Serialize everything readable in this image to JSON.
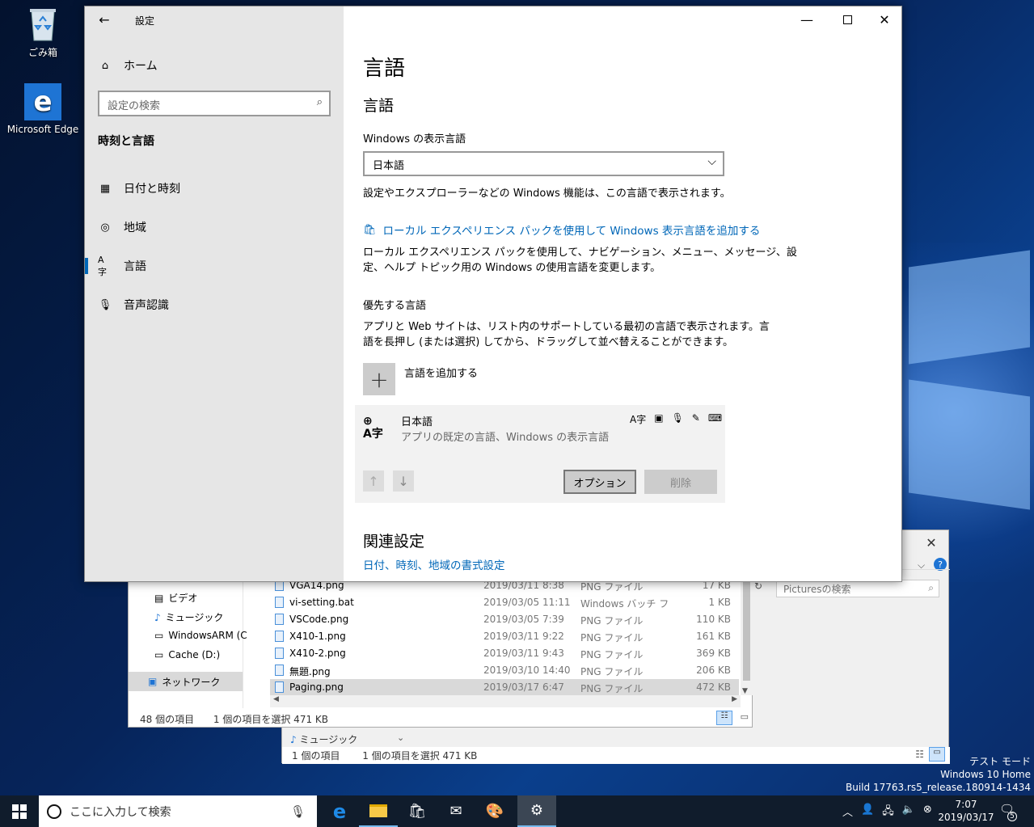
{
  "desktop": {
    "icons": [
      {
        "label": "ごみ箱"
      },
      {
        "label": "Microsoft Edge"
      }
    ],
    "watermark": {
      "line1": "テスト モード",
      "line2": "Windows 10 Home",
      "line3": "Build 17763.rs5_release.180914-1434"
    }
  },
  "explorer_back": {
    "nav_items": [
      "ビデオ",
      "ミュージック",
      "WindowsARM (C",
      "Cache (D:)",
      "ネットワーク"
    ],
    "files": [
      {
        "name": "VGA14.png",
        "date": "2019/03/11 8:38",
        "type": "PNG ファイル",
        "size": "17 KB"
      },
      {
        "name": "vi-setting.bat",
        "date": "2019/03/05 11:11",
        "type": "Windows バッチ ファ...",
        "size": "1 KB"
      },
      {
        "name": "VSCode.png",
        "date": "2019/03/05 7:39",
        "type": "PNG ファイル",
        "size": "110 KB"
      },
      {
        "name": "X410-1.png",
        "date": "2019/03/11 9:22",
        "type": "PNG ファイル",
        "size": "161 KB"
      },
      {
        "name": "X410-2.png",
        "date": "2019/03/11 9:43",
        "type": "PNG ファイル",
        "size": "369 KB"
      },
      {
        "name": "無題.png",
        "date": "2019/03/10 14:40",
        "type": "PNG ファイル",
        "size": "206 KB"
      },
      {
        "name": "Paging.png",
        "date": "2019/03/17 6:47",
        "type": "PNG ファイル",
        "size": "472 KB"
      }
    ],
    "status_count": "48 個の項目",
    "status_selected": "1 個の項目を選択  471 KB",
    "search_placeholder": "Picturesの検索",
    "help": "?"
  },
  "explorer_back2": {
    "nav_item": "ミュージック",
    "status_count": "1 個の項目",
    "status_selected": "1 個の項目を選択  471 KB"
  },
  "settings": {
    "title": "設定",
    "home": "ホーム",
    "search_placeholder": "設定の検索",
    "section": "時刻と言語",
    "nav": [
      {
        "label": "日付と時刻",
        "icon": "calendar-clock-icon"
      },
      {
        "label": "地域",
        "icon": "globe-icon"
      },
      {
        "label": "言語",
        "icon": "language-icon"
      },
      {
        "label": "音声認識",
        "icon": "microphone-icon"
      }
    ],
    "page_title": "言語",
    "subheading": "言語",
    "display_lang_label": "Windows の表示言語",
    "display_lang_value": "日本語",
    "display_lang_desc": "設定やエクスプローラーなどの Windows 機能は、この言語で表示されます。",
    "lxp_link": "ローカル エクスペリエンス パックを使用して Windows 表示言語を追加する",
    "lxp_desc_1": "ローカル エクスペリエンス パックを使用して、ナビゲーション、メニュー、メッセージ、設",
    "lxp_desc_2": "定、ヘルプ トピック用の Windows の使用言語を変更します。",
    "preferred_heading": "優先する言語",
    "preferred_desc_1": "アプリと Web サイトは、リスト内のサポートしている最初の言語で表示されます。言",
    "preferred_desc_2": "語を長押し (または選択) してから、ドラッグして並べ替えることができます。",
    "add_lang": "言語を追加する",
    "lang_item": {
      "name": "日本語",
      "desc": "アプリの既定の言語、Windows の表示言語",
      "options": "オプション",
      "remove": "削除"
    },
    "related_heading": "関連設定",
    "related_link": "日付、時刻、地域の書式設定"
  },
  "taskbar": {
    "search_placeholder": "ここに入力して検索",
    "time": "7:07",
    "date": "2019/03/17",
    "notification_count": "5"
  }
}
